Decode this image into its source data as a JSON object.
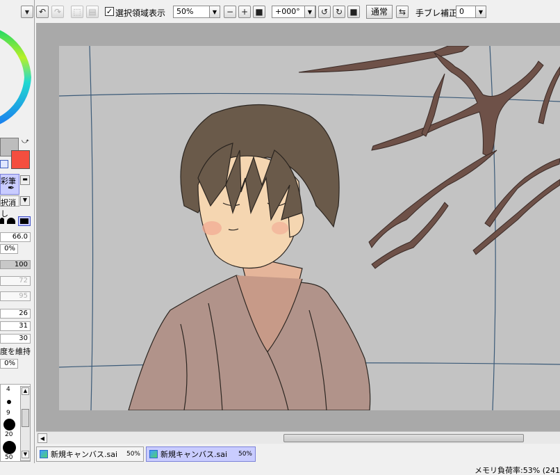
{
  "colors": {
    "accent_tab": "#c9ccff",
    "canvas_bg": "#c3c3c3",
    "workspace_bg": "#a9a9a9",
    "foreground_color": "#f44e3f",
    "background_color": "#bdbdbd"
  },
  "toolbar": {
    "show_selection_label": "選択領域表示",
    "show_selection_checked": true,
    "zoom_value": "50%",
    "rotation_value": "+000°",
    "blend_mode_label": "通常",
    "stabilizer_label": "手ブレ補正",
    "stabilizer_value": "0"
  },
  "left_panel": {
    "tool_1": "彩筆",
    "tool_2": "択消し",
    "size_value": "66.0",
    "min_size_value": "0%",
    "density_value": "100",
    "blend_value": "72",
    "dilution_value": "95",
    "persistence_value": "26",
    "value_31": "31",
    "value_30": "30",
    "keep_opacity_label": "度を維持",
    "percent_value": "0%",
    "brush_sizes": [
      "4",
      "9",
      "20",
      "50"
    ]
  },
  "tabs": [
    {
      "label": "新規キャンバス.sai",
      "zoom": "50%",
      "active": false
    },
    {
      "label": "新規キャンバス.sai",
      "zoom": "50%",
      "active": true
    }
  ],
  "status": {
    "memory": "メモリ負荷率:53% (241"
  }
}
